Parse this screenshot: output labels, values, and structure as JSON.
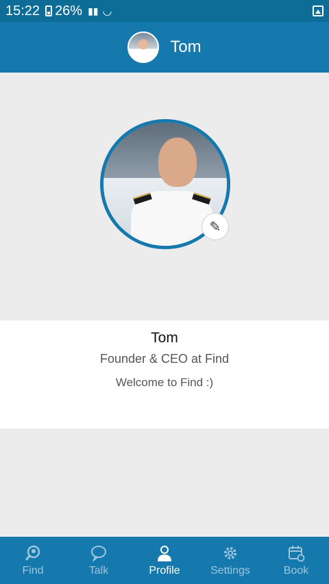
{
  "status_bar": {
    "time": "15:22",
    "battery": "26%"
  },
  "header": {
    "title": "Tom"
  },
  "profile": {
    "name": "Tom",
    "role": "Founder & CEO at Find",
    "bio": "Welcome to Find :)"
  },
  "tabs": [
    {
      "label": "Find",
      "icon": "search-person-icon",
      "active": false
    },
    {
      "label": "Talk",
      "icon": "chat-bubble-icon",
      "active": false
    },
    {
      "label": "Profile",
      "icon": "person-icon",
      "active": true
    },
    {
      "label": "Settings",
      "icon": "gear-icon",
      "active": false
    },
    {
      "label": "Book",
      "icon": "calendar-icon",
      "active": false
    }
  ],
  "colors": {
    "header_bg": "#1679ad",
    "status_bg": "#0e6d97",
    "page_bg": "#ececec",
    "tab_inactive": "#9cc6de",
    "tab_active": "#ffffff"
  }
}
